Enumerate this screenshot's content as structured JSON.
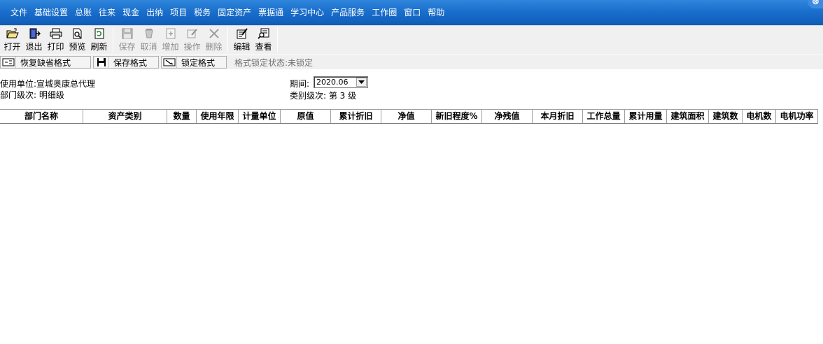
{
  "menu": [
    "文件",
    "基础设置",
    "总账",
    "往来",
    "现金",
    "出纳",
    "项目",
    "税务",
    "固定资产",
    "票据通",
    "学习中心",
    "产品服务",
    "工作圈",
    "窗口",
    "帮助"
  ],
  "toolbar": {
    "open": "打开",
    "exit": "退出",
    "print": "打印",
    "preview": "预览",
    "refresh": "刷新",
    "save": "保存",
    "cancel": "取消",
    "add": "增加",
    "operate": "操作",
    "delete": "删除",
    "edit": "编辑",
    "view": "查看"
  },
  "format_bar": {
    "restore_default": "恢复缺省格式",
    "save_format": "保存格式",
    "lock_format": "锁定格式",
    "lock_state": "格式锁定状态:未锁定"
  },
  "info": {
    "unit": "使用单位:宣城奥康总代理",
    "dept_level": "部门级次: 明细级",
    "period_label": "期间:",
    "period_value": "2020.06",
    "category_level": "类别级次: 第 3 级"
  },
  "columns": [
    "部门名称",
    "资产类别",
    "数量",
    "使用年限",
    "计量单位",
    "原值",
    "累计折旧",
    "净值",
    "新旧程度%",
    "净残值",
    "本月折旧",
    "工作总量",
    "累计用量",
    "建筑面积",
    "建筑数",
    "电机数",
    "电机功率"
  ]
}
